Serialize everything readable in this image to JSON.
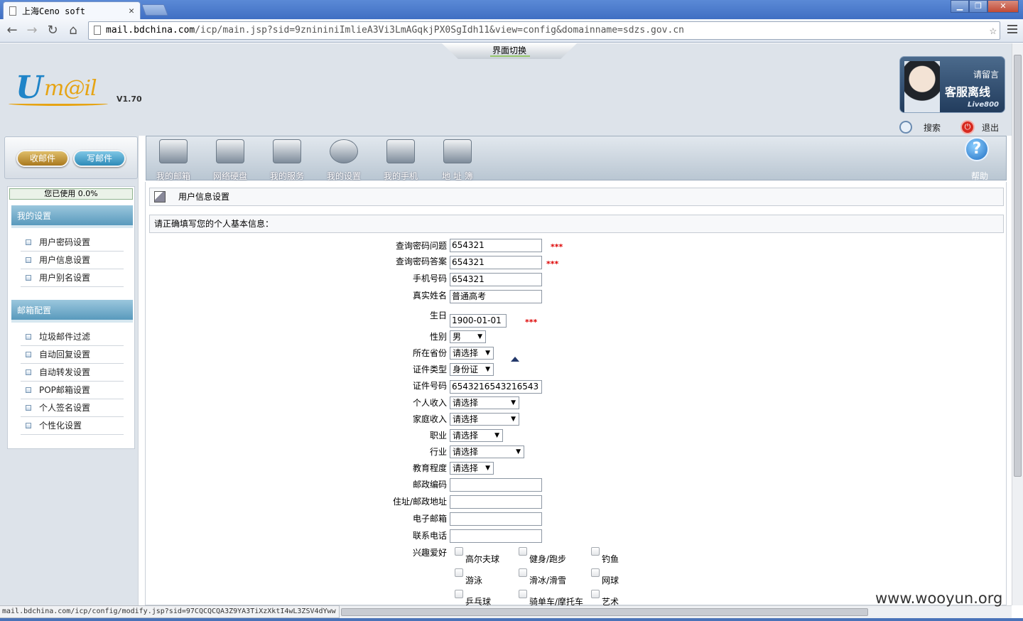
{
  "browser": {
    "tab_title": "上海Ceno soft",
    "url_host": "mail.bdchina.com",
    "url_rest": "/icp/main.jsp?sid=9znininiImlieA3Vi3LmAGqkjPX0SgIdh11&view=config&domainname=sdzs.gov.cn",
    "status_url": "mail.bdchina.com/icp/config/modify.jsp?sid=97CQCQCQA3Z9YA3TiXzXktI4wL3ZSV4dYww"
  },
  "header": {
    "switch_label": "界面切换",
    "logo_u": "U",
    "logo_rest": "m@il",
    "version": "V1.70",
    "live_line1": "请留言",
    "live_line2": "客服离线",
    "live_brand": "Live800",
    "search": "搜索",
    "logout": "退出"
  },
  "left": {
    "receive": "收邮件",
    "compose": "写邮件",
    "usage": "您已使用 0.0%",
    "section1": "我的设置",
    "section1_items": [
      "用户密码设置",
      "用户信息设置",
      "用户别名设置"
    ],
    "section2": "邮箱配置",
    "section2_items": [
      "垃圾邮件过滤",
      "自动回复设置",
      "自动转发设置",
      "POP邮箱设置",
      "个人签名设置",
      "个性化设置"
    ]
  },
  "nav": {
    "items": [
      "我的邮箱",
      "网络硬盘",
      "我的服务",
      "我的设置",
      "我的手机",
      "地 址 簿"
    ],
    "help": "帮助"
  },
  "content": {
    "title": "用户信息设置",
    "hint": "请正确填写您的个人基本信息：",
    "required_mark": "***",
    "fields": {
      "pwd_question": {
        "label": "查询密码问题",
        "value": "654321"
      },
      "pwd_answer": {
        "label": "查询密码答案",
        "value": "654321"
      },
      "mobile": {
        "label": "手机号码",
        "value": "654321"
      },
      "real_name": {
        "label": "真实姓名",
        "value": "普通高考"
      },
      "birthday": {
        "label": "生日",
        "value": "1900-01-01"
      },
      "gender": {
        "label": "性别",
        "value": "男"
      },
      "province": {
        "label": "所在省份",
        "value": "请选择"
      },
      "id_type": {
        "label": "证件类型",
        "value": "身份证"
      },
      "id_number": {
        "label": "证件号码",
        "value": "6543216543216543"
      },
      "income": {
        "label": "个人收入",
        "value": "请选择"
      },
      "family_income": {
        "label": "家庭收入",
        "value": "请选择"
      },
      "job": {
        "label": "职业",
        "value": "请选择"
      },
      "industry": {
        "label": "行业",
        "value": "请选择"
      },
      "education": {
        "label": "教育程度",
        "value": "请选择"
      },
      "zipcode": {
        "label": "邮政编码",
        "value": ""
      },
      "address": {
        "label": "住址/邮政地址",
        "value": ""
      },
      "email": {
        "label": "电子邮箱",
        "value": ""
      },
      "phone": {
        "label": "联系电话",
        "value": ""
      }
    },
    "hobby_label": "兴趣爱好",
    "hobbies": [
      "高尔夫球",
      "健身/跑步",
      "钓鱼",
      "游泳",
      "滑冰/滑雪",
      "网球",
      "乒乓球",
      "骑单车/摩托车",
      "艺术"
    ]
  },
  "watermark": "www.wooyun.org"
}
